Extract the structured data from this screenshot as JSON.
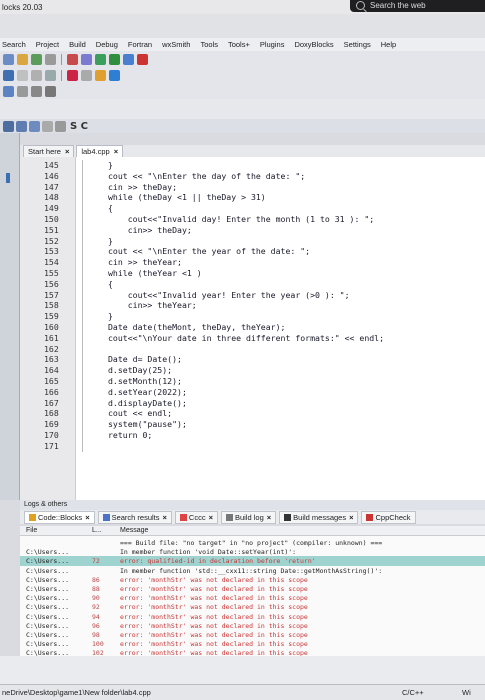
{
  "window": {
    "title": "locks 20.03",
    "search_web": "Search the web"
  },
  "menu": [
    "Search",
    "Project",
    "Build",
    "Debug",
    "Fortran",
    "wxSmith",
    "Tools",
    "Tools+",
    "Plugins",
    "DoxyBlocks",
    "Settings",
    "Help"
  ],
  "toolbar_small": {
    "label": "S C"
  },
  "editor_tabs": [
    {
      "label": "Start here",
      "active": false
    },
    {
      "label": "lab4.cpp",
      "active": true
    }
  ],
  "code_lines": [
    {
      "n": "145",
      "text": "}"
    },
    {
      "n": "146",
      "text": "cout << \"\\nEnter the day of the date: \";"
    },
    {
      "n": "147",
      "text": "cin >> theDay;"
    },
    {
      "n": "148",
      "text": "while (theDay <1 || theDay > 31)"
    },
    {
      "n": "149",
      "text": "{"
    },
    {
      "n": "150",
      "text": "    cout<<\"Invalid day! Enter the month (1 to 31 ): \";"
    },
    {
      "n": "151",
      "text": "    cin>> theDay;"
    },
    {
      "n": "152",
      "text": "}"
    },
    {
      "n": "153",
      "text": "cout << \"\\nEnter the year of the date: \";"
    },
    {
      "n": "154",
      "text": "cin >> theYear;"
    },
    {
      "n": "155",
      "text": "while (theYear <1 )"
    },
    {
      "n": "156",
      "text": "{"
    },
    {
      "n": "157",
      "text": "    cout<<\"Invalid year! Enter the year (>0 ): \";"
    },
    {
      "n": "158",
      "text": "    cin>> theYear;"
    },
    {
      "n": "159",
      "text": "}"
    },
    {
      "n": "160",
      "text": "Date date(theMont, theDay, theYear);"
    },
    {
      "n": "161",
      "text": "cout<<\"\\nYour date in three different formats:\" << endl;"
    },
    {
      "n": "162",
      "text": ""
    },
    {
      "n": "163",
      "text": "Date d= Date();"
    },
    {
      "n": "164",
      "text": "d.setDay(25);"
    },
    {
      "n": "165",
      "text": "d.setMonth(12);"
    },
    {
      "n": "166",
      "text": "d.setYear(2022);"
    },
    {
      "n": "167",
      "text": "d.displayDate();"
    },
    {
      "n": "168",
      "text": "cout << endl;"
    },
    {
      "n": "169",
      "text": "system(\"pause\");"
    },
    {
      "n": "170",
      "text": "return 0;"
    },
    {
      "n": "171",
      "text": ""
    }
  ],
  "logs": {
    "header": "Logs & others",
    "tabs": [
      {
        "label": "Code::Blocks",
        "active": true
      },
      {
        "label": "Search results",
        "active": false
      },
      {
        "label": "Cccc",
        "active": false
      },
      {
        "label": "Build log",
        "active": false
      },
      {
        "label": "Build messages",
        "active": false
      },
      {
        "label": "CppCheck",
        "active": false
      }
    ],
    "columns": [
      "File",
      "L...",
      "Message"
    ],
    "rows": [
      {
        "file": "",
        "line": "",
        "msg": "=== Build file: \"no target\" in \"no project\" (compiler: unknown) ===",
        "type": "info"
      },
      {
        "file": "C:\\Users...",
        "line": "",
        "msg": "In member function 'void Date::setYear(int)':",
        "type": "info"
      },
      {
        "file": "C:\\Users...",
        "line": "72",
        "msg": "error: qualified-id in declaration before 'return'",
        "type": "err",
        "hl": true
      },
      {
        "file": "C:\\Users...",
        "line": "",
        "msg": "In member function 'std::__cxx11::string Date::getMonthAsString()':",
        "type": "info"
      },
      {
        "file": "C:\\Users...",
        "line": "86",
        "msg": "error: 'monthStr' was not declared in this scope",
        "type": "err"
      },
      {
        "file": "C:\\Users...",
        "line": "88",
        "msg": "error: 'monthStr' was not declared in this scope",
        "type": "err"
      },
      {
        "file": "C:\\Users...",
        "line": "90",
        "msg": "error: 'monthStr' was not declared in this scope",
        "type": "err"
      },
      {
        "file": "C:\\Users...",
        "line": "92",
        "msg": "error: 'monthStr' was not declared in this scope",
        "type": "err"
      },
      {
        "file": "C:\\Users...",
        "line": "94",
        "msg": "error: 'monthStr' was not declared in this scope",
        "type": "err"
      },
      {
        "file": "C:\\Users...",
        "line": "96",
        "msg": "error: 'monthStr' was not declared in this scope",
        "type": "err"
      },
      {
        "file": "C:\\Users...",
        "line": "98",
        "msg": "error: 'monthStr' was not declared in this scope",
        "type": "err"
      },
      {
        "file": "C:\\Users...",
        "line": "100",
        "msg": "error: 'monthStr' was not declared in this scope",
        "type": "err"
      },
      {
        "file": "C:\\Users...",
        "line": "102",
        "msg": "error: 'monthStr' was not declared in this scope",
        "type": "err"
      }
    ]
  },
  "status": {
    "path": "neDrive\\Desktop\\game1\\New folder\\lab4.cpp",
    "language": "C/C++",
    "mode": "Wi"
  }
}
